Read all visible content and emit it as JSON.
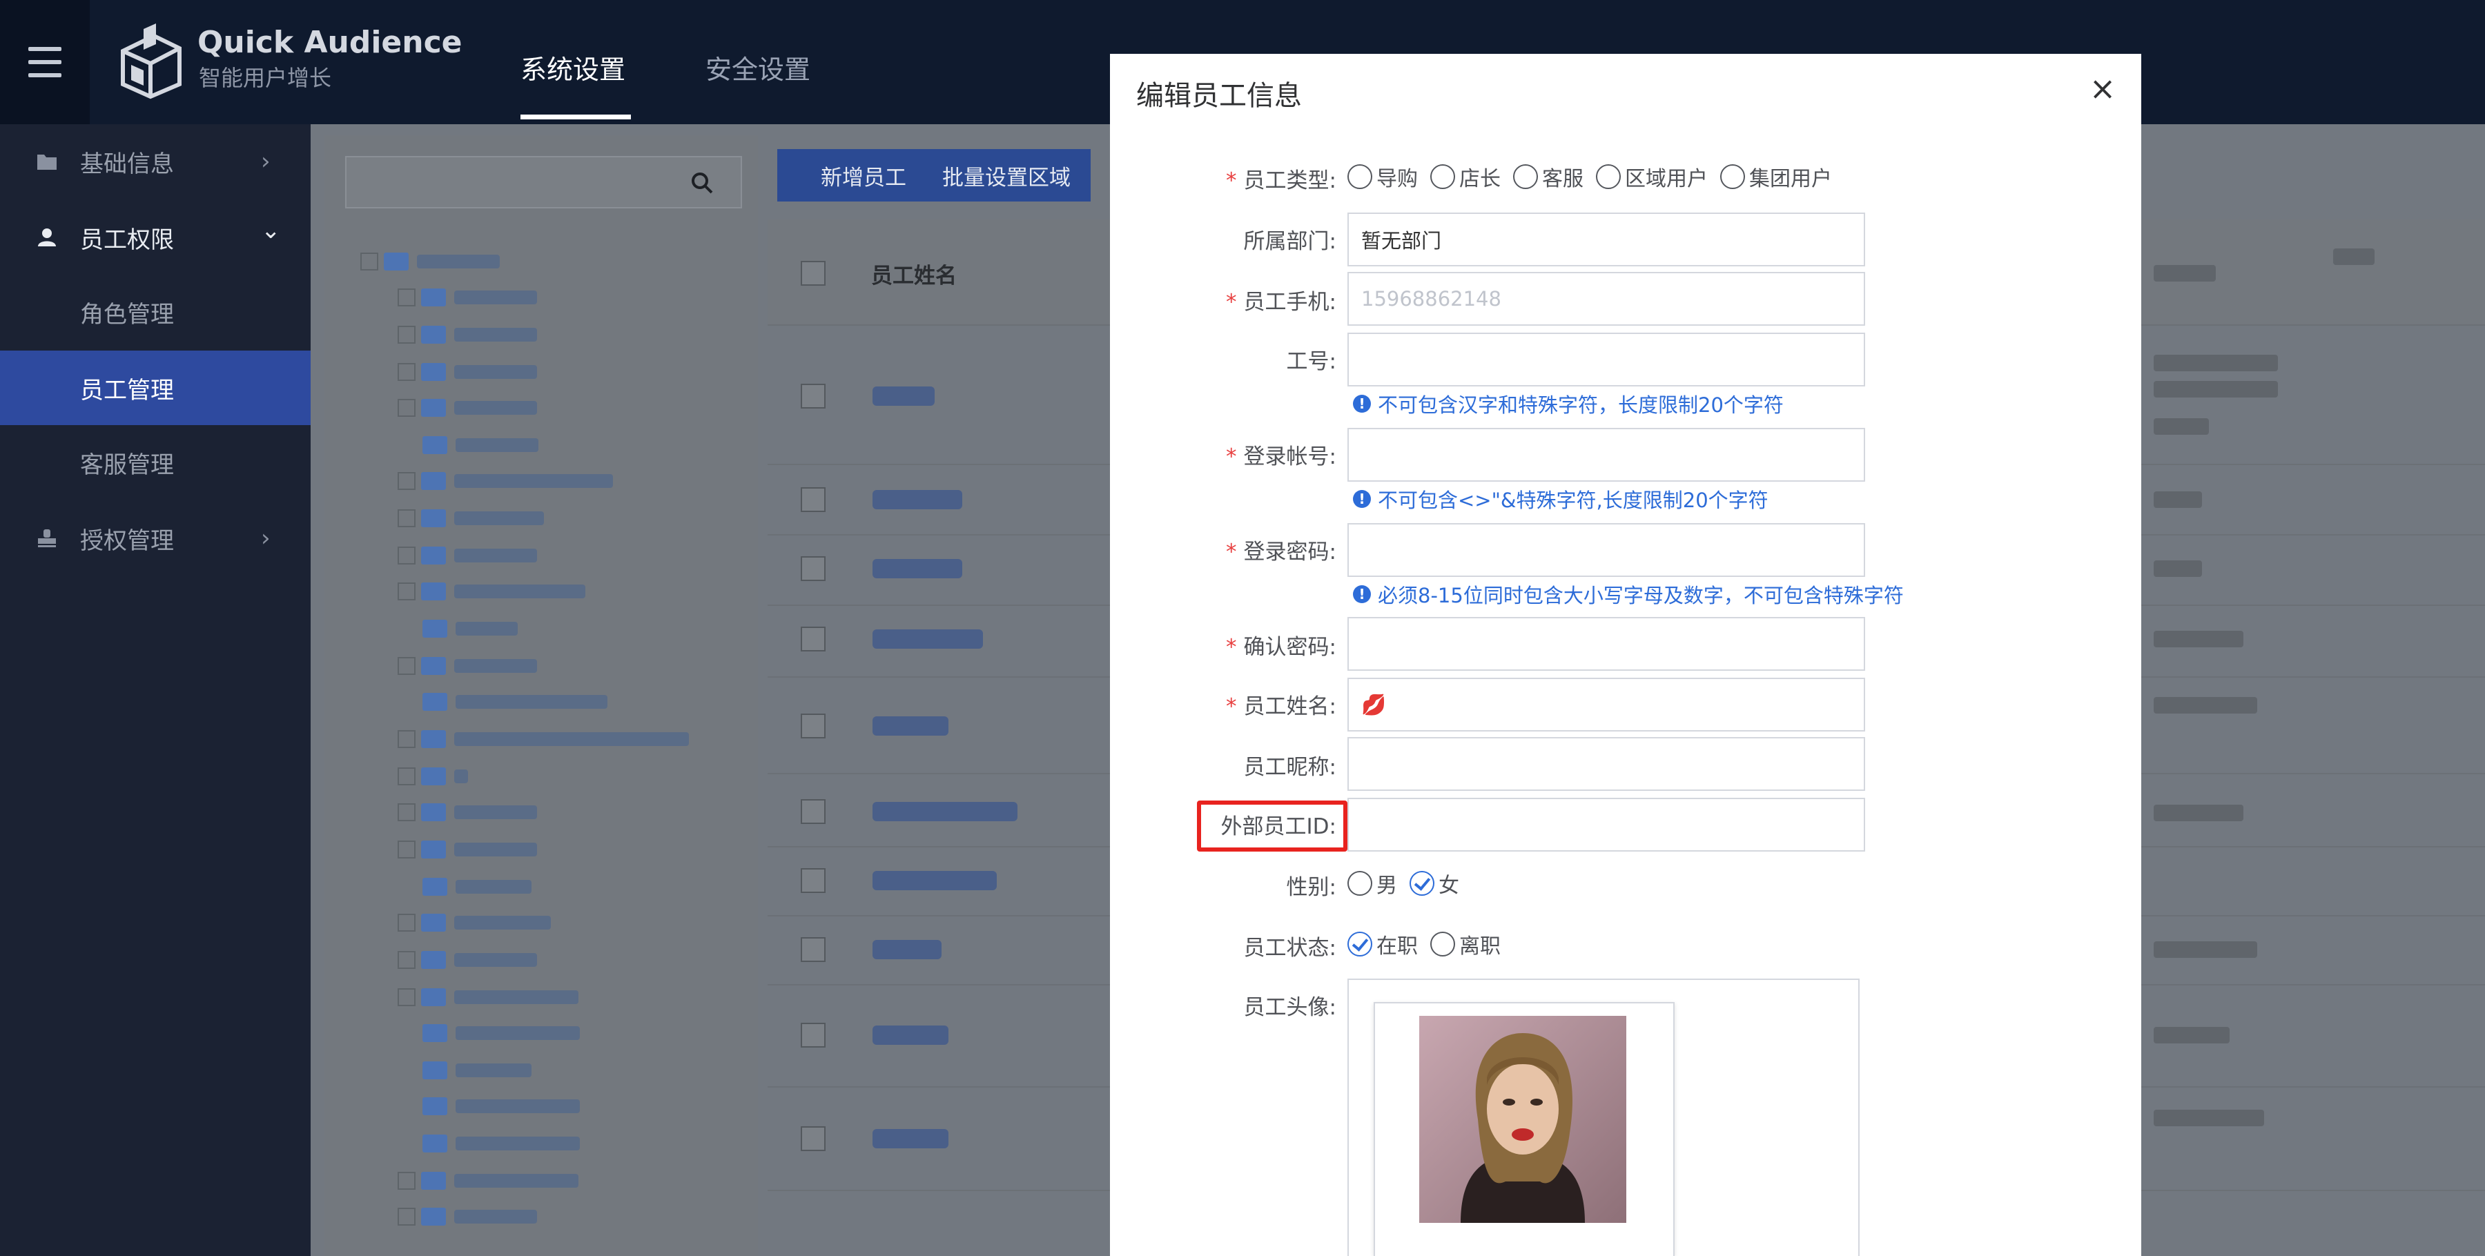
{
  "header": {
    "brand_title": "Quick Audience",
    "brand_subtitle": "智能用户增长",
    "tabs": [
      {
        "label": "系统设置",
        "active": true
      },
      {
        "label": "安全设置",
        "active": false
      }
    ]
  },
  "sidebar": {
    "items": [
      {
        "label": "基础信息",
        "icon": "folder-icon",
        "arrow": "›"
      },
      {
        "label": "员工权限",
        "icon": "user-icon",
        "arrow": "⌄"
      },
      {
        "label": "角色管理"
      },
      {
        "label": "员工管理",
        "active": true
      },
      {
        "label": "客服管理"
      },
      {
        "label": "授权管理",
        "icon": "stamp-icon",
        "arrow": "›"
      }
    ]
  },
  "toolbar": {
    "add_employee": "新增员工",
    "batch_set_region": "批量设置区域"
  },
  "table": {
    "header_name": "员工姓名"
  },
  "modal": {
    "title": "编辑员工信息",
    "close": "×",
    "fields": {
      "type_label": "员工类型:",
      "type_options": [
        "导购",
        "店长",
        "客服",
        "区域用户",
        "集团用户"
      ],
      "dept_label": "所属部门:",
      "dept_value": "暂无部门",
      "phone_label": "员工手机:",
      "phone_value": "15968862148",
      "job_no_label": "工号:",
      "job_no_hint": "不可包含汉字和特殊字符，长度限制20个字符",
      "account_label": "登录帐号:",
      "account_hint": "不可包含<>\"&特殊字符,长度限制20个字符",
      "password_label": "登录密码:",
      "password_hint": "必须8-15位同时包含大小写字母及数字，不可包含特殊字符",
      "confirm_label": "确认密码:",
      "name_label": "员工姓名:",
      "name_value": "💋",
      "nickname_label": "员工昵称:",
      "external_id_label": "外部员工ID:",
      "gender_label": "性别:",
      "gender_options": [
        "男",
        "女"
      ],
      "gender_selected": "女",
      "status_label": "员工状态:",
      "status_options": [
        "在职",
        "离职"
      ],
      "status_selected": "在职",
      "avatar_label": "员工头像:"
    }
  },
  "colors": {
    "primary": "#2d6cd8",
    "required": "#e84141",
    "highlight": "#e8231f",
    "sidebar_active": "#2e4a9f"
  }
}
